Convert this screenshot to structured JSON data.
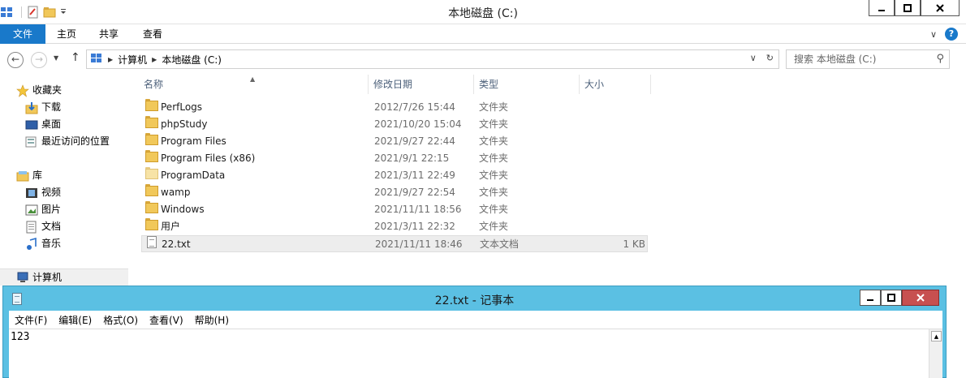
{
  "explorer": {
    "title": "本地磁盘 (C:)",
    "ribbon_tabs": [
      "文件",
      "主页",
      "共享",
      "查看"
    ],
    "breadcrumb": [
      "计算机",
      "本地磁盘 (C:)"
    ],
    "search_placeholder": "搜索 本地磁盘 (C:)",
    "nav": {
      "favorites_label": "收藏夹",
      "favorites": [
        "下载",
        "桌面",
        "最近访问的位置"
      ],
      "library_label": "库",
      "libraries": [
        "视频",
        "图片",
        "文档",
        "音乐"
      ],
      "computer_label": "计算机"
    },
    "columns": [
      "名称",
      "修改日期",
      "类型",
      "大小"
    ],
    "files": [
      {
        "name": "PerfLogs",
        "date": "2012/7/26 15:44",
        "type": "文件夹",
        "size": "",
        "icon": "folder-icon"
      },
      {
        "name": "phpStudy",
        "date": "2021/10/20 15:04",
        "type": "文件夹",
        "size": "",
        "icon": "folder-icon"
      },
      {
        "name": "Program Files",
        "date": "2021/9/27 22:44",
        "type": "文件夹",
        "size": "",
        "icon": "folder-icon"
      },
      {
        "name": "Program Files (x86)",
        "date": "2021/9/1 22:15",
        "type": "文件夹",
        "size": "",
        "icon": "folder-icon"
      },
      {
        "name": "ProgramData",
        "date": "2021/3/11 22:49",
        "type": "文件夹",
        "size": "",
        "icon": "hidden-folder-icon"
      },
      {
        "name": "wamp",
        "date": "2021/9/27 22:54",
        "type": "文件夹",
        "size": "",
        "icon": "folder-icon"
      },
      {
        "name": "Windows",
        "date": "2021/11/11 18:56",
        "type": "文件夹",
        "size": "",
        "icon": "folder-icon"
      },
      {
        "name": "用户",
        "date": "2021/3/11 22:32",
        "type": "文件夹",
        "size": "",
        "icon": "folder-icon"
      },
      {
        "name": "22.txt",
        "date": "2021/11/11 18:46",
        "type": "文本文档",
        "size": "1 KB",
        "icon": "text-file-icon"
      }
    ]
  },
  "notepad": {
    "title": "22.txt - 记事本",
    "menus": [
      "文件(F)",
      "编辑(E)",
      "格式(O)",
      "查看(V)",
      "帮助(H)"
    ],
    "content": "123"
  },
  "colors": {
    "ribbon_file_tab": "#1979ca",
    "notepad_frame": "#5bc0e3",
    "close_button": "#c75050"
  }
}
